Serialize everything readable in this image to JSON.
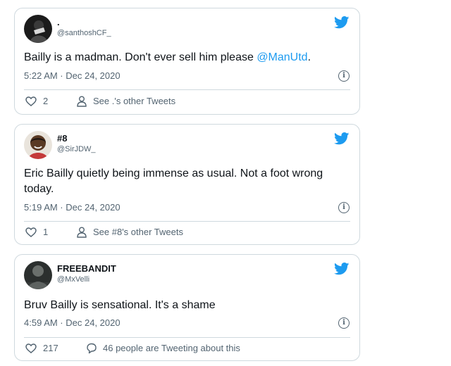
{
  "tweets": [
    {
      "display_name": ".",
      "handle": "@santhoshCF_",
      "text_before": "Bailly is a madman. Don't ever sell him please ",
      "mention": "@ManUtd",
      "text_after": ".",
      "timestamp": "5:22 AM · Dec 24, 2020",
      "like_count": "2",
      "action_label": "See .'s other Tweets",
      "action_icon": "person-icon"
    },
    {
      "display_name": "#8",
      "handle": "@SirJDW_",
      "text_before": "Eric Bailly quietly being immense as usual. Not a foot wrong today.",
      "mention": "",
      "text_after": "",
      "timestamp": "5:19 AM · Dec 24, 2020",
      "like_count": "1",
      "action_label": "See #8's other Tweets",
      "action_icon": "person-icon"
    },
    {
      "display_name": "FREEBANDIT",
      "handle": "@MxVelli",
      "text_before": "Bruv Bailly is sensational. It's a shame",
      "mention": "",
      "text_after": "",
      "timestamp": "4:59 AM · Dec 24, 2020",
      "like_count": "217",
      "action_label": "46 people are Tweeting about this",
      "action_icon": "speech-bubble-icon"
    }
  ],
  "colors": {
    "brand_blue": "#1d9bf0",
    "text_primary": "#0f1419",
    "text_secondary": "#536471",
    "border": "#cfd9de"
  },
  "icons": {
    "brand": "twitter-bird-icon",
    "info": "info-icon",
    "like": "heart-icon"
  },
  "info_glyph": "i"
}
